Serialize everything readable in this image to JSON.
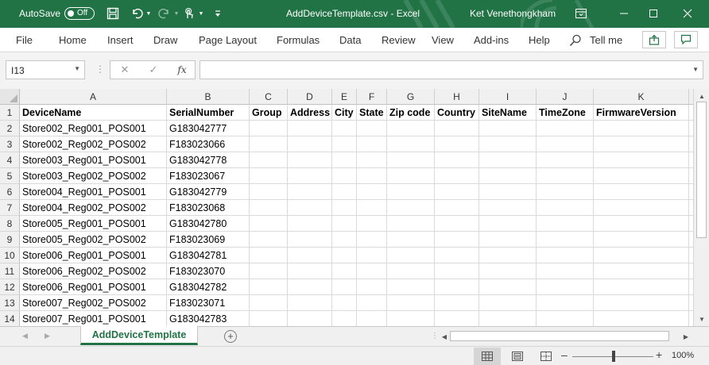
{
  "titlebar": {
    "autosave_label": "AutoSave",
    "autosave_state": "Off",
    "document_title": "AddDeviceTemplate.csv  -  Excel",
    "user_name": "Ket Venethongkham",
    "bg_color": "#217346"
  },
  "ribbon": {
    "tabs": [
      "File",
      "Home",
      "Insert",
      "Draw",
      "Page Layout",
      "Formulas",
      "Data",
      "Review",
      "View",
      "Add-ins",
      "Help"
    ],
    "tell_me": "Tell me"
  },
  "formula_bar": {
    "name_box": "I13",
    "fx_label": "fx",
    "value": ""
  },
  "grid": {
    "columns": [
      "A",
      "B",
      "C",
      "D",
      "E",
      "F",
      "G",
      "H",
      "I",
      "J",
      "K"
    ],
    "header_row": [
      "DeviceName",
      "SerialNumber",
      "Group",
      "Address",
      "City",
      "State",
      "Zip code",
      "Country",
      "SiteName",
      "TimeZone",
      "FirmwareVersion"
    ],
    "rows": [
      {
        "num": "1"
      },
      {
        "num": "2",
        "name": "Store002_Reg001_POS001",
        "serial": "G183042777"
      },
      {
        "num": "3",
        "name": "Store002_Reg002_POS002",
        "serial": "F183023066"
      },
      {
        "num": "4",
        "name": "Store003_Reg001_POS001",
        "serial": "G183042778"
      },
      {
        "num": "5",
        "name": "Store003_Reg002_POS002",
        "serial": "F183023067"
      },
      {
        "num": "6",
        "name": "Store004_Reg001_POS001",
        "serial": "G183042779"
      },
      {
        "num": "7",
        "name": "Store004_Reg002_POS002",
        "serial": "F183023068"
      },
      {
        "num": "8",
        "name": "Store005_Reg001_POS001",
        "serial": "G183042780"
      },
      {
        "num": "9",
        "name": "Store005_Reg002_POS002",
        "serial": "F183023069"
      },
      {
        "num": "10",
        "name": "Store006_Reg001_POS001",
        "serial": "G183042781"
      },
      {
        "num": "11",
        "name": "Store006_Reg002_POS002",
        "serial": "F183023070"
      },
      {
        "num": "12",
        "name": "Store006_Reg001_POS001",
        "serial": "G183042782"
      },
      {
        "num": "13",
        "name": "Store007_Reg002_POS002",
        "serial": "F183023071"
      },
      {
        "num": "14",
        "name": "Store007_Reg001_POS001",
        "serial": "G183042783"
      }
    ]
  },
  "sheets": {
    "active": "AddDeviceTemplate",
    "accent_color": "#217346"
  },
  "statusbar": {
    "zoom": "100%",
    "view_icons": [
      "normal-view-icon",
      "page-layout-view-icon",
      "page-break-view-icon"
    ]
  }
}
